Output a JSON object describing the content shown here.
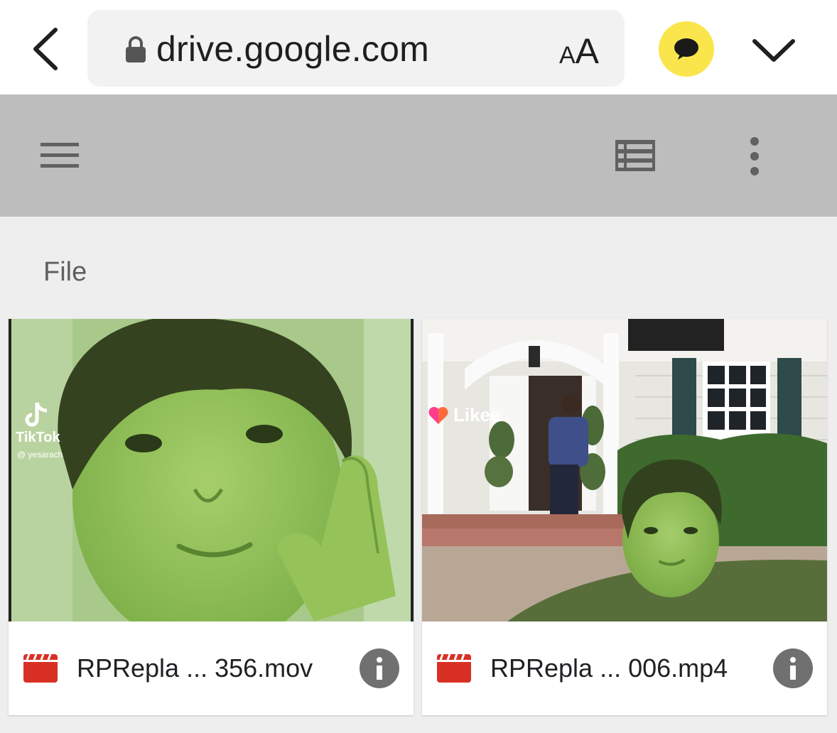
{
  "browser": {
    "url": "drive.google.com",
    "text_size_small": "A",
    "text_size_big": "A",
    "back_icon": "chevron-left-icon",
    "lock_icon": "lock-icon",
    "extension_icon": "kakaotalk-speech-bubble-icon",
    "menu_icon": "chevron-down-icon",
    "extension_color": "#fae64c"
  },
  "drive_toolbar": {
    "menu_icon": "hamburger-menu-icon",
    "view_icon": "list-view-icon",
    "more_icon": "more-vertical-icon",
    "background": "#bdbdbd"
  },
  "section": {
    "title": "File"
  },
  "files": [
    {
      "name": "RPRepla ... 356.mov",
      "type_icon": "video-file-icon",
      "info_icon": "info-icon",
      "thumbnail": {
        "watermark_app": "TikTok",
        "watermark_user": "@ yesarach"
      }
    },
    {
      "name": "RPRepla ... 006.mp4",
      "type_icon": "video-file-icon",
      "info_icon": "info-icon",
      "thumbnail": {
        "watermark_app": "Likee"
      }
    }
  ],
  "colors": {
    "video_icon": "#d93025",
    "info_button": "#707070",
    "page_background": "#eeeeee"
  }
}
